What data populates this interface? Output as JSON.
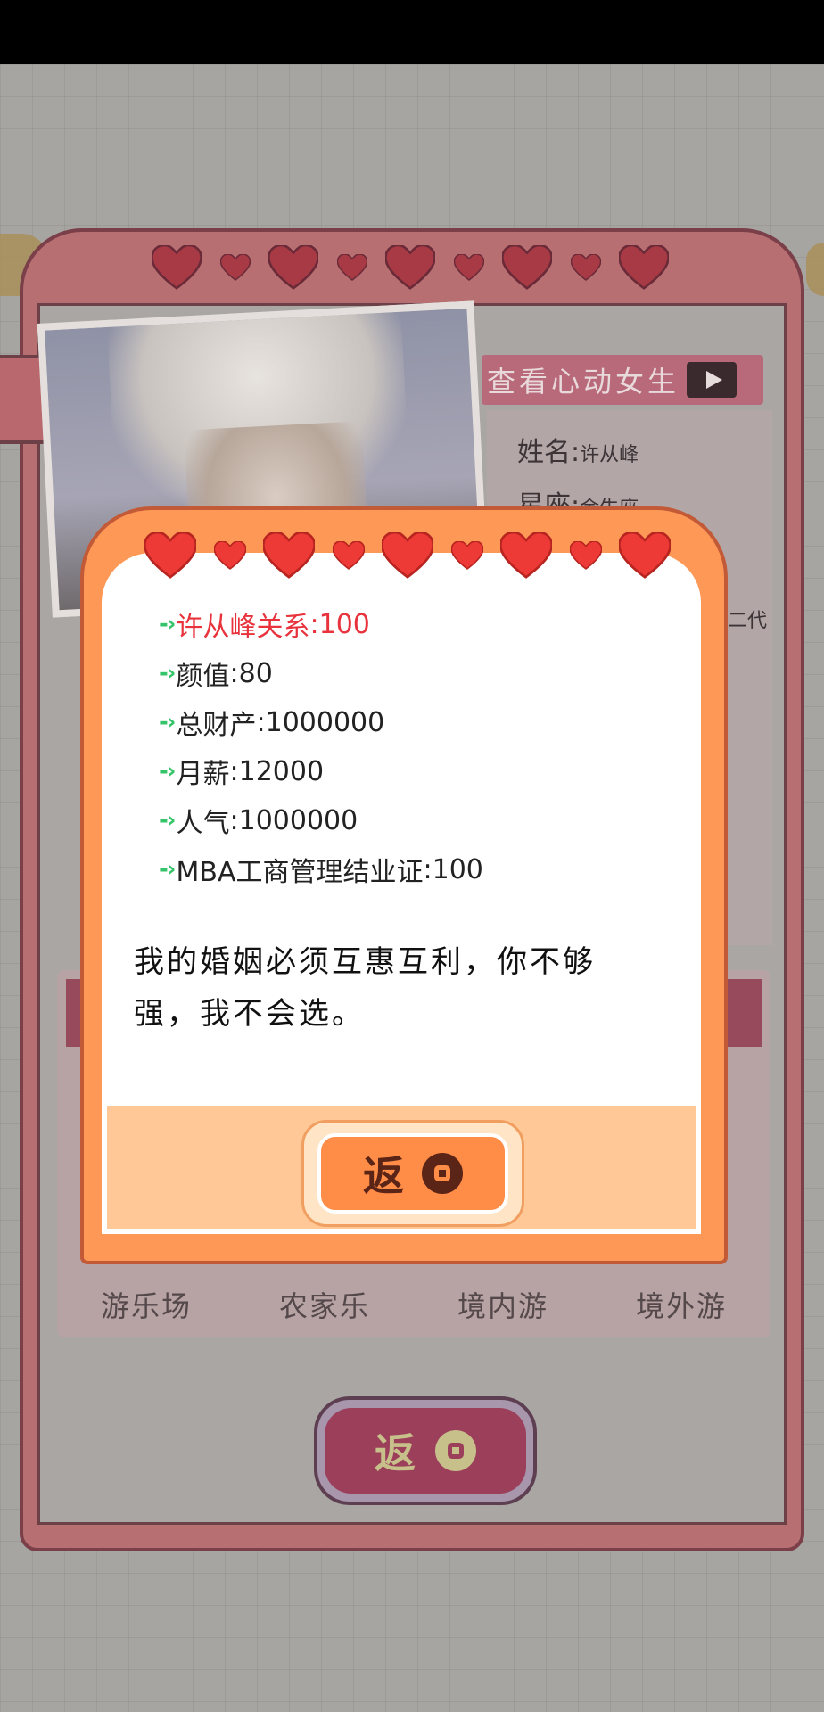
{
  "profile": {
    "view_girl_label": "查看心动女生",
    "name_label": "姓名",
    "name_value": "许从峰",
    "zodiac_label": "星座",
    "zodiac_value": "金牛座",
    "partial_text": "二代",
    "places": [
      "游乐场",
      "农家乐",
      "境内游",
      "境外游"
    ],
    "return_label": "返"
  },
  "dialog": {
    "stats": [
      {
        "label": "许从峰关系",
        "value": "100"
      },
      {
        "label": "颜值",
        "value": "80"
      },
      {
        "label": "总财产",
        "value": "1000000"
      },
      {
        "label": "月薪",
        "value": "12000"
      },
      {
        "label": "人气",
        "value": "1000000"
      },
      {
        "label": "MBA工商管理结业证",
        "value": "100"
      }
    ],
    "arrow": "-›",
    "colon": ":",
    "quote_line1": "我的婚姻必须互惠互利，你不够",
    "quote_line2": "强，我不会选。",
    "return_label": "返"
  },
  "colors": {
    "relation_red": "#e8333d",
    "arrow_green": "#36c46a",
    "dialog_orange": "#fd9856",
    "button_orange": "#ff8c47"
  }
}
